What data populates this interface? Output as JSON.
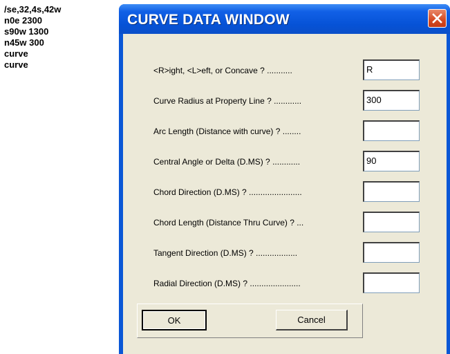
{
  "command_log": {
    "lines": [
      "/se,32,4s,42w",
      "n0e 2300",
      "s90w 1300",
      "n45w 300",
      "curve",
      "curve"
    ]
  },
  "dialog": {
    "title": "CURVE DATA WINDOW",
    "fields": [
      {
        "label": "<R>ight, <L>eft, or Concave ? ...........",
        "value": "R"
      },
      {
        "label": "Curve Radius at Property Line ? ............",
        "value": "300"
      },
      {
        "label": "Arc Length (Distance with curve) ? ........",
        "value": ""
      },
      {
        "label": "Central Angle or Delta (D.MS) ? ............",
        "value": "90"
      },
      {
        "label": "Chord Direction (D.MS) ? .......................",
        "value": ""
      },
      {
        "label": "Chord Length (Distance Thru Curve) ? ...",
        "value": ""
      },
      {
        "label": "Tangent Direction (D.MS) ? ..................",
        "value": ""
      },
      {
        "label": "Radial Direction (D.MS) ? ......................",
        "value": ""
      }
    ],
    "ok_label": "OK",
    "cancel_label": "Cancel"
  },
  "icons": {
    "close": "close-icon"
  },
  "colors": {
    "titlebar": "#0a57d6",
    "close_button": "#d64a22",
    "client": "#ece9d8"
  }
}
